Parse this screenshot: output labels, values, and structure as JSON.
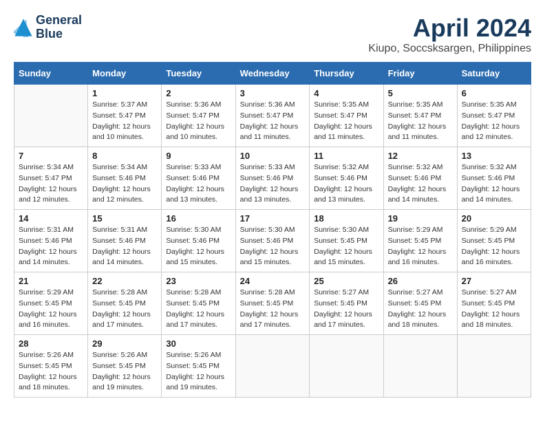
{
  "header": {
    "logo_line1": "General",
    "logo_line2": "Blue",
    "month_title": "April 2024",
    "location": "Kiupo, Soccsksargen, Philippines"
  },
  "weekdays": [
    "Sunday",
    "Monday",
    "Tuesday",
    "Wednesday",
    "Thursday",
    "Friday",
    "Saturday"
  ],
  "weeks": [
    [
      {
        "day": "",
        "sunrise": "",
        "sunset": "",
        "daylight": ""
      },
      {
        "day": "1",
        "sunrise": "Sunrise: 5:37 AM",
        "sunset": "Sunset: 5:47 PM",
        "daylight": "Daylight: 12 hours and 10 minutes."
      },
      {
        "day": "2",
        "sunrise": "Sunrise: 5:36 AM",
        "sunset": "Sunset: 5:47 PM",
        "daylight": "Daylight: 12 hours and 10 minutes."
      },
      {
        "day": "3",
        "sunrise": "Sunrise: 5:36 AM",
        "sunset": "Sunset: 5:47 PM",
        "daylight": "Daylight: 12 hours and 11 minutes."
      },
      {
        "day": "4",
        "sunrise": "Sunrise: 5:35 AM",
        "sunset": "Sunset: 5:47 PM",
        "daylight": "Daylight: 12 hours and 11 minutes."
      },
      {
        "day": "5",
        "sunrise": "Sunrise: 5:35 AM",
        "sunset": "Sunset: 5:47 PM",
        "daylight": "Daylight: 12 hours and 11 minutes."
      },
      {
        "day": "6",
        "sunrise": "Sunrise: 5:35 AM",
        "sunset": "Sunset: 5:47 PM",
        "daylight": "Daylight: 12 hours and 12 minutes."
      }
    ],
    [
      {
        "day": "7",
        "sunrise": "Sunrise: 5:34 AM",
        "sunset": "Sunset: 5:47 PM",
        "daylight": "Daylight: 12 hours and 12 minutes."
      },
      {
        "day": "8",
        "sunrise": "Sunrise: 5:34 AM",
        "sunset": "Sunset: 5:46 PM",
        "daylight": "Daylight: 12 hours and 12 minutes."
      },
      {
        "day": "9",
        "sunrise": "Sunrise: 5:33 AM",
        "sunset": "Sunset: 5:46 PM",
        "daylight": "Daylight: 12 hours and 13 minutes."
      },
      {
        "day": "10",
        "sunrise": "Sunrise: 5:33 AM",
        "sunset": "Sunset: 5:46 PM",
        "daylight": "Daylight: 12 hours and 13 minutes."
      },
      {
        "day": "11",
        "sunrise": "Sunrise: 5:32 AM",
        "sunset": "Sunset: 5:46 PM",
        "daylight": "Daylight: 12 hours and 13 minutes."
      },
      {
        "day": "12",
        "sunrise": "Sunrise: 5:32 AM",
        "sunset": "Sunset: 5:46 PM",
        "daylight": "Daylight: 12 hours and 14 minutes."
      },
      {
        "day": "13",
        "sunrise": "Sunrise: 5:32 AM",
        "sunset": "Sunset: 5:46 PM",
        "daylight": "Daylight: 12 hours and 14 minutes."
      }
    ],
    [
      {
        "day": "14",
        "sunrise": "Sunrise: 5:31 AM",
        "sunset": "Sunset: 5:46 PM",
        "daylight": "Daylight: 12 hours and 14 minutes."
      },
      {
        "day": "15",
        "sunrise": "Sunrise: 5:31 AM",
        "sunset": "Sunset: 5:46 PM",
        "daylight": "Daylight: 12 hours and 14 minutes."
      },
      {
        "day": "16",
        "sunrise": "Sunrise: 5:30 AM",
        "sunset": "Sunset: 5:46 PM",
        "daylight": "Daylight: 12 hours and 15 minutes."
      },
      {
        "day": "17",
        "sunrise": "Sunrise: 5:30 AM",
        "sunset": "Sunset: 5:46 PM",
        "daylight": "Daylight: 12 hours and 15 minutes."
      },
      {
        "day": "18",
        "sunrise": "Sunrise: 5:30 AM",
        "sunset": "Sunset: 5:45 PM",
        "daylight": "Daylight: 12 hours and 15 minutes."
      },
      {
        "day": "19",
        "sunrise": "Sunrise: 5:29 AM",
        "sunset": "Sunset: 5:45 PM",
        "daylight": "Daylight: 12 hours and 16 minutes."
      },
      {
        "day": "20",
        "sunrise": "Sunrise: 5:29 AM",
        "sunset": "Sunset: 5:45 PM",
        "daylight": "Daylight: 12 hours and 16 minutes."
      }
    ],
    [
      {
        "day": "21",
        "sunrise": "Sunrise: 5:29 AM",
        "sunset": "Sunset: 5:45 PM",
        "daylight": "Daylight: 12 hours and 16 minutes."
      },
      {
        "day": "22",
        "sunrise": "Sunrise: 5:28 AM",
        "sunset": "Sunset: 5:45 PM",
        "daylight": "Daylight: 12 hours and 17 minutes."
      },
      {
        "day": "23",
        "sunrise": "Sunrise: 5:28 AM",
        "sunset": "Sunset: 5:45 PM",
        "daylight": "Daylight: 12 hours and 17 minutes."
      },
      {
        "day": "24",
        "sunrise": "Sunrise: 5:28 AM",
        "sunset": "Sunset: 5:45 PM",
        "daylight": "Daylight: 12 hours and 17 minutes."
      },
      {
        "day": "25",
        "sunrise": "Sunrise: 5:27 AM",
        "sunset": "Sunset: 5:45 PM",
        "daylight": "Daylight: 12 hours and 17 minutes."
      },
      {
        "day": "26",
        "sunrise": "Sunrise: 5:27 AM",
        "sunset": "Sunset: 5:45 PM",
        "daylight": "Daylight: 12 hours and 18 minutes."
      },
      {
        "day": "27",
        "sunrise": "Sunrise: 5:27 AM",
        "sunset": "Sunset: 5:45 PM",
        "daylight": "Daylight: 12 hours and 18 minutes."
      }
    ],
    [
      {
        "day": "28",
        "sunrise": "Sunrise: 5:26 AM",
        "sunset": "Sunset: 5:45 PM",
        "daylight": "Daylight: 12 hours and 18 minutes."
      },
      {
        "day": "29",
        "sunrise": "Sunrise: 5:26 AM",
        "sunset": "Sunset: 5:45 PM",
        "daylight": "Daylight: 12 hours and 19 minutes."
      },
      {
        "day": "30",
        "sunrise": "Sunrise: 5:26 AM",
        "sunset": "Sunset: 5:45 PM",
        "daylight": "Daylight: 12 hours and 19 minutes."
      },
      {
        "day": "",
        "sunrise": "",
        "sunset": "",
        "daylight": ""
      },
      {
        "day": "",
        "sunrise": "",
        "sunset": "",
        "daylight": ""
      },
      {
        "day": "",
        "sunrise": "",
        "sunset": "",
        "daylight": ""
      },
      {
        "day": "",
        "sunrise": "",
        "sunset": "",
        "daylight": ""
      }
    ]
  ]
}
